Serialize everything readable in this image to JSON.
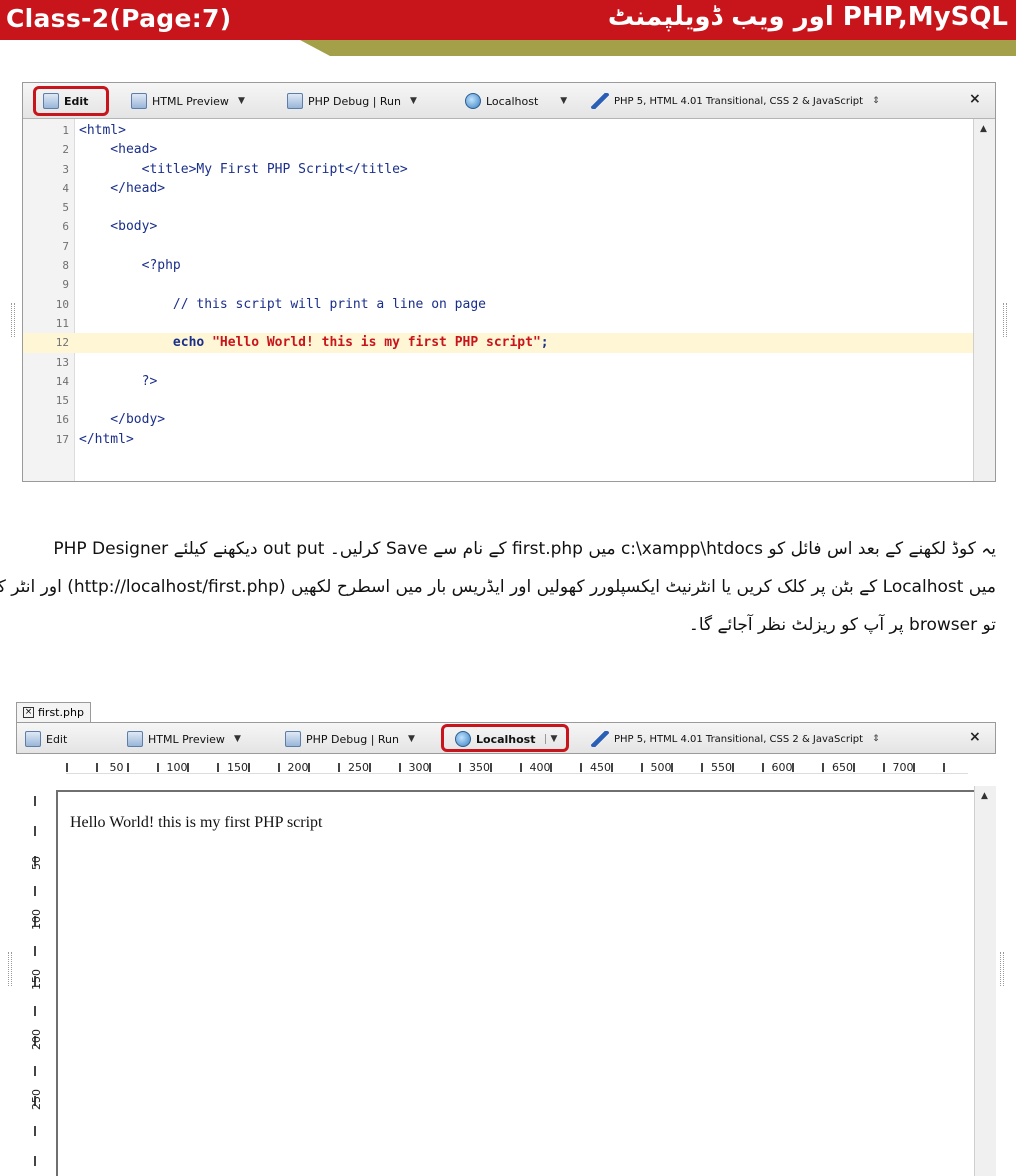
{
  "header": {
    "left_title": "Class-2(Page:7)",
    "right_title": "PHP,MySQL اور ویب ڈویلپمنٹ"
  },
  "editor": {
    "toolbar": {
      "edit": "Edit",
      "html_preview": "HTML Preview",
      "php_debug": "PHP Debug | Run",
      "localhost": "Localhost",
      "doctype": "PHP 5, HTML 4.01 Transitional, CSS 2 & JavaScript",
      "close": "×"
    },
    "lines": [
      {
        "n": "1",
        "text": "<html>"
      },
      {
        "n": "2",
        "text": "    <head>"
      },
      {
        "n": "3",
        "text": "        <title>My First PHP Script</title>"
      },
      {
        "n": "4",
        "text": "    </head>"
      },
      {
        "n": "5",
        "text": ""
      },
      {
        "n": "6",
        "text": "    <body>"
      },
      {
        "n": "7",
        "text": ""
      },
      {
        "n": "8",
        "text": "        <?php"
      },
      {
        "n": "9",
        "text": ""
      },
      {
        "n": "10",
        "text": "            // this script will print a line on page"
      },
      {
        "n": "11",
        "text": ""
      },
      {
        "n": "12",
        "pre": "            echo ",
        "str": "\"Hello World! this is my first PHP script\"",
        "post": ";"
      },
      {
        "n": "13",
        "text": ""
      },
      {
        "n": "14",
        "text": "        ?>"
      },
      {
        "n": "15",
        "text": ""
      },
      {
        "n": "16",
        "text": "    </body>"
      },
      {
        "n": "17",
        "text": "</html>"
      }
    ]
  },
  "paragraph": {
    "line1": "یہ کوڈ لکھنے کے بعد اس فائل کو c:\\xampp\\htdocs میں first.php کے نام سے Save کرلیں۔ out put دیکھنے کیلئے PHP Designer",
    "line2": "میں Localhost کے بٹن پر کلک کریں یا انٹرنیٹ ایکسپلورر کھولیں اور ایڈریس بار میں اسطرح لکھیں (http://localhost/first.php) اور انٹر کردیں",
    "line3": "تو browser پر آپ کو ریزلٹ نظر آجائے گا۔"
  },
  "preview": {
    "file_tab": "first.php",
    "toolbar": {
      "edit": "Edit",
      "html_preview": "HTML Preview",
      "php_debug": "PHP Debug | Run",
      "localhost": "Localhost",
      "doctype": "PHP 5, HTML 4.01 Transitional, CSS 2 & JavaScript",
      "close": "×"
    },
    "ruler_h": [
      "50",
      "100",
      "150",
      "200",
      "250",
      "300",
      "350",
      "400",
      "450",
      "500",
      "550",
      "600",
      "650",
      "700"
    ],
    "ruler_v": [
      "50",
      "100",
      "150",
      "200",
      "250"
    ],
    "output_text": "Hello World! this is my first PHP script"
  }
}
